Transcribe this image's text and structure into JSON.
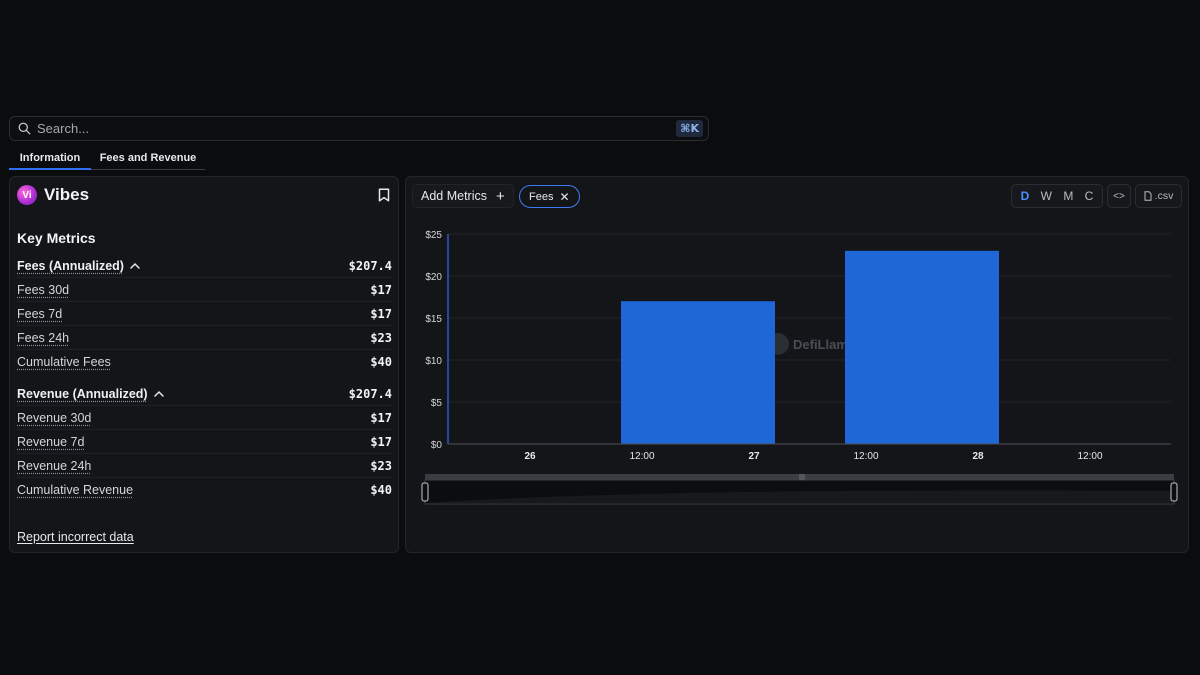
{
  "search": {
    "placeholder": "Search...",
    "shortcut": "⌘K"
  },
  "tabs": [
    {
      "label": "Information",
      "active": true
    },
    {
      "label": "Fees and Revenue",
      "active": false
    }
  ],
  "protocol": {
    "logo_text": "Vi",
    "name": "Vibes"
  },
  "key_metrics": {
    "title": "Key Metrics",
    "fees": {
      "annualized": {
        "label": "Fees (Annualized)",
        "value": "$207.4"
      },
      "rows": [
        {
          "label": "Fees 30d",
          "value": "$17"
        },
        {
          "label": "Fees 7d",
          "value": "$17"
        },
        {
          "label": "Fees 24h",
          "value": "$23"
        },
        {
          "label": "Cumulative Fees",
          "value": "$40"
        }
      ]
    },
    "revenue": {
      "annualized": {
        "label": "Revenue (Annualized)",
        "value": "$207.4"
      },
      "rows": [
        {
          "label": "Revenue 30d",
          "value": "$17"
        },
        {
          "label": "Revenue 7d",
          "value": "$17"
        },
        {
          "label": "Revenue 24h",
          "value": "$23"
        },
        {
          "label": "Cumulative Revenue",
          "value": "$40"
        }
      ]
    },
    "report_link": "Report incorrect data"
  },
  "toolbar": {
    "add_metrics": "Add Metrics",
    "chip": "Fees",
    "periods": [
      "D",
      "W",
      "M",
      "C"
    ],
    "active_period": "D",
    "embed_label": "<>",
    "csv_label": ".csv"
  },
  "watermark": "DefiLlama",
  "colors": {
    "accent": "#2f6ef5",
    "bar": "#1f66d6",
    "background": "#0b0c0e",
    "panel": "#141518"
  },
  "chart_data": {
    "type": "bar",
    "x_ticks": [
      {
        "label": "26",
        "bold": true
      },
      {
        "label": "12:00",
        "bold": false
      },
      {
        "label": "27",
        "bold": true
      },
      {
        "label": "12:00",
        "bold": false
      },
      {
        "label": "28",
        "bold": true
      },
      {
        "label": "12:00",
        "bold": false
      }
    ],
    "y_ticks": [
      "$0",
      "$5",
      "$10",
      "$15",
      "$20",
      "$25"
    ],
    "ylim": [
      0,
      25
    ],
    "bars": [
      {
        "date": "27",
        "value": 17
      },
      {
        "date": "28",
        "value": 23
      }
    ],
    "series": [
      {
        "name": "Fees",
        "values": [
          17,
          23
        ]
      }
    ],
    "grid": true,
    "data_zoom": true
  }
}
